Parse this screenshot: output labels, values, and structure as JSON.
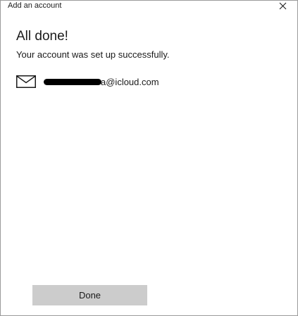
{
  "window": {
    "title": "Add an account",
    "close_glyph": "✕"
  },
  "content": {
    "heading": "All done!",
    "message": "Your account was set up successfully.",
    "account": {
      "icon": "mail-icon",
      "email_visible": "a@icloud.com",
      "redacted": true
    }
  },
  "footer": {
    "done_label": "Done"
  },
  "colors": {
    "background": "#ffffff",
    "button_bg": "#cccccc",
    "text": "#1a1a1a",
    "border": "#9a9a9a"
  }
}
